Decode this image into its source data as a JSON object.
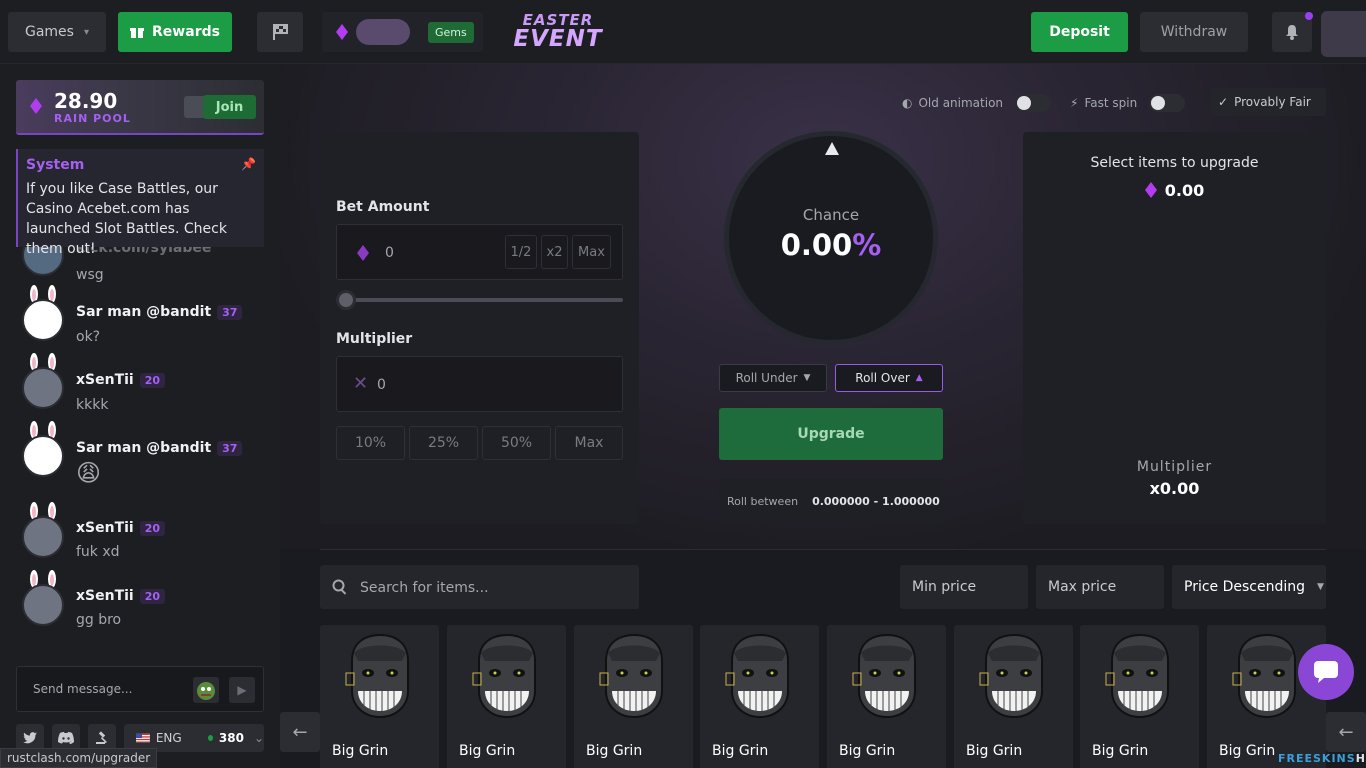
{
  "topbar": {
    "games_label": "Games",
    "rewards_label": "Rewards",
    "gems_label": "Gems",
    "easter_line1": "EASTER",
    "easter_line2": "EVENT",
    "deposit_label": "Deposit",
    "withdraw_label": "Withdraw"
  },
  "sidebar": {
    "rain_amount": "28.90",
    "rain_label": "RAIN POOL",
    "join_label": "Join",
    "system_title": "System",
    "system_text": "If you like Case Battles, our Casino Acebet.com has launched Slot Battles. Check them out!",
    "partial_message": {
      "name": "kick.com/sylabee",
      "text": "wsg"
    },
    "messages": [
      {
        "name": "Sar man @bandit",
        "level": "37",
        "text": "ok?"
      },
      {
        "name": "xSenTii",
        "level": "20",
        "text": "kkkk"
      },
      {
        "name": "Sar man @bandit",
        "level": "37",
        "text": "😩"
      },
      {
        "name": "xSenTii",
        "level": "20",
        "text": "fuk xd"
      },
      {
        "name": "xSenTii",
        "level": "20",
        "text": "gg bro"
      }
    ],
    "send_placeholder": "Send message...",
    "language": "ENG",
    "online_count": "380"
  },
  "status_url": "rustclash.com/upgrader",
  "options": {
    "old_animation": "Old animation",
    "fast_spin": "Fast spin",
    "provably_fair": "Provably Fair"
  },
  "bet": {
    "bet_label": "Bet Amount",
    "bet_value": "0",
    "half": "1/2",
    "double": "x2",
    "max": "Max",
    "multiplier_label": "Multiplier",
    "multiplier_value": "0",
    "presets": [
      "10%",
      "25%",
      "50%",
      "Max"
    ]
  },
  "wheel": {
    "chance_label": "Chance",
    "chance_number": "0.00",
    "chance_percent": "%"
  },
  "roll": {
    "under_label": "Roll Under",
    "over_label": "Roll Over",
    "upgrade_label": "Upgrade",
    "between_label": "Roll between",
    "between_value": "0.000000 - 1.000000"
  },
  "target": {
    "title": "Select items to upgrade",
    "value": "0.00",
    "multiplier_label": "Multiplier",
    "multiplier_value": "x0.00"
  },
  "filters": {
    "search_placeholder": "Search for items...",
    "min_price": "Min price",
    "max_price": "Max price",
    "sort": "Price Descending"
  },
  "items": [
    "Big Grin",
    "Big Grin",
    "Big Grin",
    "Big Grin",
    "Big Grin",
    "Big Grin",
    "Big Grin",
    "Big Grin"
  ],
  "branding": {
    "part1": "FREESKINS",
    "part2": "HUB"
  },
  "colors": {
    "accent_purple": "#a560f2",
    "green": "#1c9d45",
    "background": "#17191c"
  }
}
